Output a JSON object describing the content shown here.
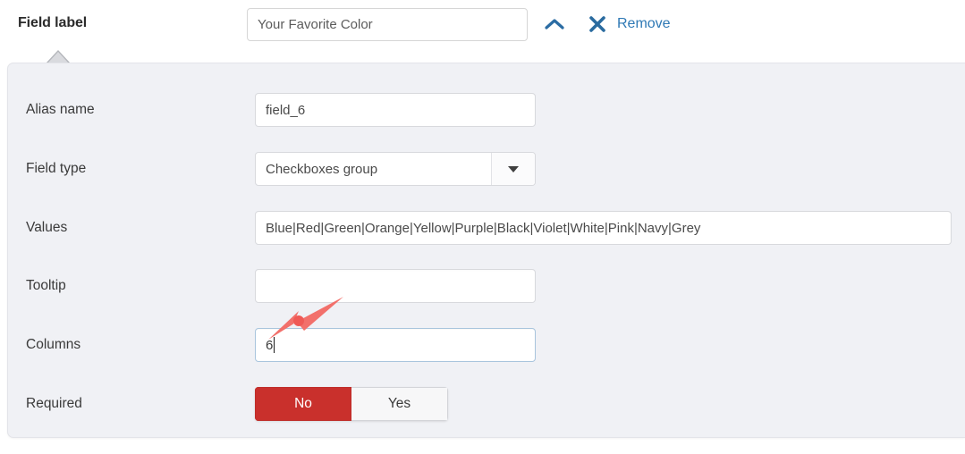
{
  "header": {
    "label": "Field label",
    "field_value": "Your Favorite Color",
    "field_placeholder": "Field label",
    "collapse_icon": "chevron-up-icon",
    "remove_icon": "close-x-icon",
    "remove_label": "Remove",
    "link_color": "#2f79b5"
  },
  "panel": {
    "background_color": "#f0f1f5",
    "rows": [
      {
        "label": "Alias name",
        "type": "text",
        "value": "field_6",
        "placeholder": ""
      },
      {
        "label": "Field type",
        "type": "select",
        "value": "Checkboxes group",
        "options": [
          "Checkboxes group"
        ]
      },
      {
        "label": "Values",
        "type": "text",
        "value": "Blue|Red|Green|Orange|Yellow|Purple|Black|Violet|White|Pink|Navy|Grey",
        "placeholder": ""
      },
      {
        "label": "Tooltip",
        "type": "text",
        "value": "",
        "placeholder": ""
      },
      {
        "label": "Columns",
        "type": "text",
        "value": "6",
        "placeholder": "",
        "focused": true
      },
      {
        "label": "Required",
        "type": "toggle",
        "options": [
          "No",
          "Yes"
        ],
        "selected": "No",
        "active_color": "#c9302c"
      }
    ]
  },
  "annotation": {
    "type": "arrow",
    "color": "#f2706b",
    "points_to": "columns-input"
  }
}
